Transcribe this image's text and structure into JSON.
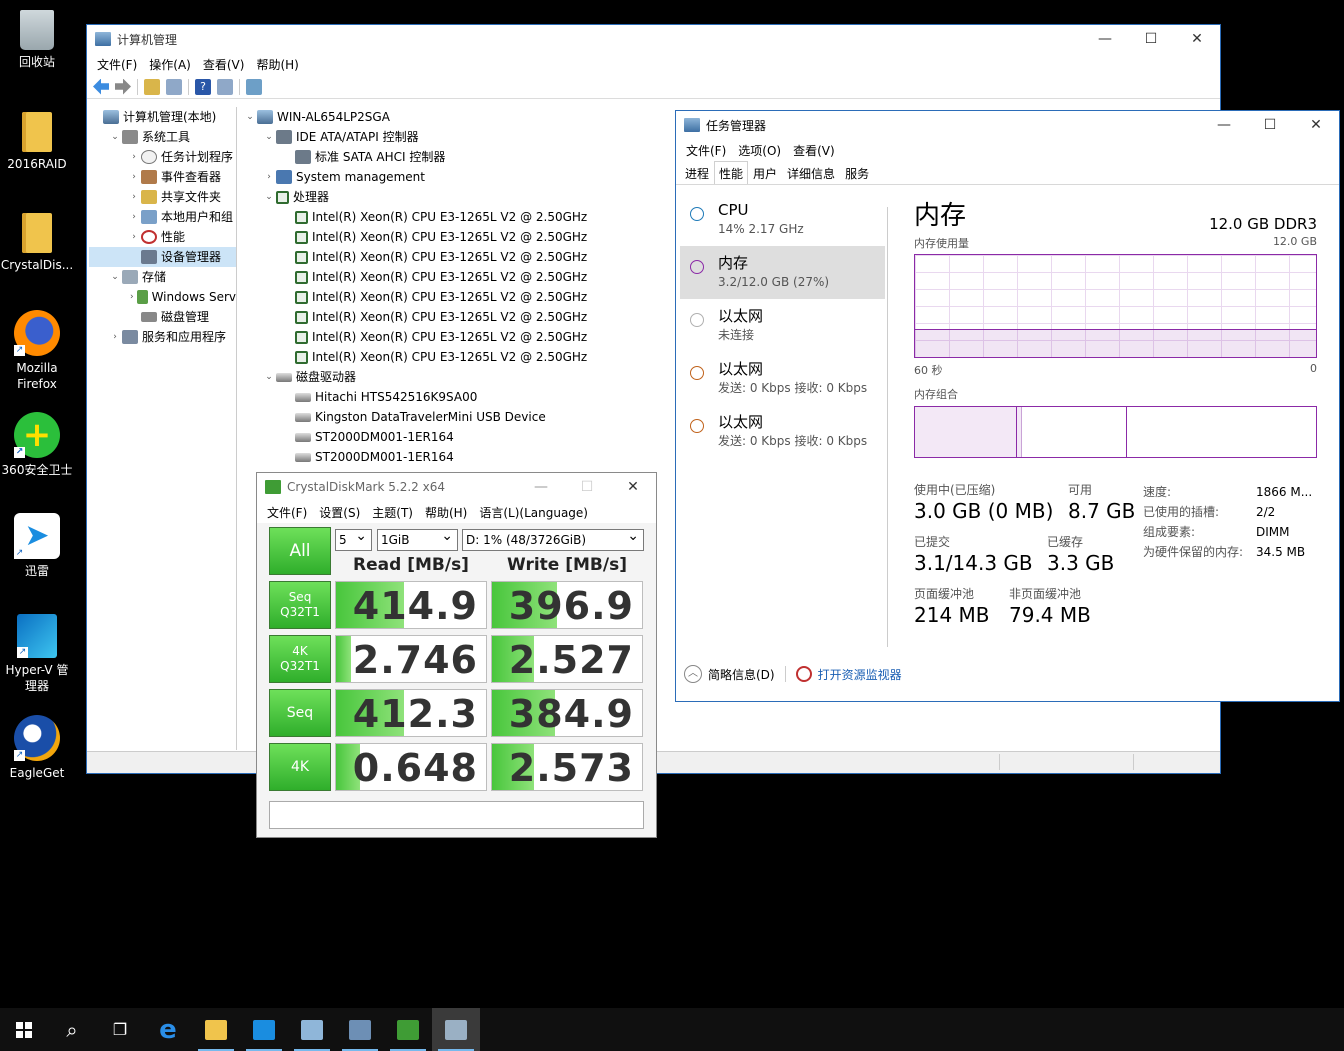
{
  "desktop": {
    "icons": [
      {
        "label": "回收站",
        "icon": "recycle-bin-icon"
      },
      {
        "label": "2016RAID",
        "icon": "folder-icon"
      },
      {
        "label": "CrystalDis...",
        "icon": "folder-icon"
      },
      {
        "label": "Mozilla\nFirefox",
        "icon": "firefox-icon"
      },
      {
        "label": "360安全卫士",
        "icon": "360-safe-icon"
      },
      {
        "label": "迅雷",
        "icon": "xunlei-icon"
      },
      {
        "label": "Hyper-V 管\n理器",
        "icon": "hyperv-icon"
      },
      {
        "label": "EagleGet",
        "icon": "eagleget-icon"
      }
    ]
  },
  "computer_management": {
    "title": "计算机管理",
    "menu": [
      "文件(F)",
      "操作(A)",
      "查看(V)",
      "帮助(H)"
    ],
    "left_tree": [
      {
        "label": "计算机管理(本地)",
        "level": 0,
        "icon": "computer-icon",
        "arrow": ""
      },
      {
        "label": "系统工具",
        "level": 1,
        "icon": "tools-icon",
        "arrow": "expanded"
      },
      {
        "label": "任务计划程序",
        "level": 2,
        "icon": "clock-icon",
        "arrow": "collapsed"
      },
      {
        "label": "事件查看器",
        "level": 2,
        "icon": "event-viewer-icon",
        "arrow": "collapsed"
      },
      {
        "label": "共享文件夹",
        "level": 2,
        "icon": "shared-folder-icon",
        "arrow": "collapsed"
      },
      {
        "label": "本地用户和组",
        "level": 2,
        "icon": "users-icon",
        "arrow": "collapsed"
      },
      {
        "label": "性能",
        "level": 2,
        "icon": "performance-icon",
        "arrow": "collapsed"
      },
      {
        "label": "设备管理器",
        "level": 2,
        "icon": "device-manager-icon",
        "arrow": "",
        "selected": true
      },
      {
        "label": "存储",
        "level": 1,
        "icon": "storage-icon",
        "arrow": "expanded"
      },
      {
        "label": "Windows Serv",
        "level": 2,
        "icon": "windows-server-backup-icon",
        "arrow": "collapsed"
      },
      {
        "label": "磁盘管理",
        "level": 2,
        "icon": "disk-icon",
        "arrow": ""
      },
      {
        "label": "服务和应用程序",
        "level": 1,
        "icon": "services-icon",
        "arrow": "collapsed"
      }
    ],
    "device_tree": [
      {
        "label": "WIN-AL654LP2SGA",
        "level": 0,
        "icon": "computer-icon",
        "arrow": "expanded"
      },
      {
        "label": "IDE ATA/ATAPI 控制器",
        "level": 1,
        "icon": "ide-controller-icon",
        "arrow": "expanded"
      },
      {
        "label": "标准 SATA AHCI 控制器",
        "level": 2,
        "icon": "ide-controller-icon",
        "arrow": ""
      },
      {
        "label": "System management",
        "level": 1,
        "icon": "system-icon",
        "arrow": "collapsed"
      },
      {
        "label": "处理器",
        "level": 1,
        "icon": "processor-icon",
        "arrow": "expanded"
      },
      {
        "label": "Intel(R) Xeon(R) CPU E3-1265L V2 @ 2.50GHz",
        "level": 2,
        "icon": "processor-icon",
        "arrow": ""
      },
      {
        "label": "Intel(R) Xeon(R) CPU E3-1265L V2 @ 2.50GHz",
        "level": 2,
        "icon": "processor-icon",
        "arrow": ""
      },
      {
        "label": "Intel(R) Xeon(R) CPU E3-1265L V2 @ 2.50GHz",
        "level": 2,
        "icon": "processor-icon",
        "arrow": ""
      },
      {
        "label": "Intel(R) Xeon(R) CPU E3-1265L V2 @ 2.50GHz",
        "level": 2,
        "icon": "processor-icon",
        "arrow": ""
      },
      {
        "label": "Intel(R) Xeon(R) CPU E3-1265L V2 @ 2.50GHz",
        "level": 2,
        "icon": "processor-icon",
        "arrow": ""
      },
      {
        "label": "Intel(R) Xeon(R) CPU E3-1265L V2 @ 2.50GHz",
        "level": 2,
        "icon": "processor-icon",
        "arrow": ""
      },
      {
        "label": "Intel(R) Xeon(R) CPU E3-1265L V2 @ 2.50GHz",
        "level": 2,
        "icon": "processor-icon",
        "arrow": ""
      },
      {
        "label": "Intel(R) Xeon(R) CPU E3-1265L V2 @ 2.50GHz",
        "level": 2,
        "icon": "processor-icon",
        "arrow": ""
      },
      {
        "label": "磁盘驱动器",
        "level": 1,
        "icon": "disk-drive-icon",
        "arrow": "expanded"
      },
      {
        "label": "Hitachi HTS542516K9SA00",
        "level": 2,
        "icon": "disk-drive-icon",
        "arrow": ""
      },
      {
        "label": "Kingston DataTravelerMini USB Device",
        "level": 2,
        "icon": "disk-drive-icon",
        "arrow": ""
      },
      {
        "label": "ST2000DM001-1ER164",
        "level": 2,
        "icon": "disk-drive-icon",
        "arrow": ""
      },
      {
        "label": "ST2000DM001-1ER164",
        "level": 2,
        "icon": "disk-drive-icon",
        "arrow": ""
      }
    ]
  },
  "task_manager": {
    "title": "任务管理器",
    "menu": [
      "文件(F)",
      "选项(O)",
      "查看(V)"
    ],
    "tabs": [
      "进程",
      "性能",
      "用户",
      "详细信息",
      "服务"
    ],
    "active_tab": 1,
    "side_items": [
      {
        "title": "CPU",
        "sub": "14% 2.17 GHz",
        "color": "#1f7ab8"
      },
      {
        "title": "内存",
        "sub": "3.2/12.0 GB (27%)",
        "color": "#8b2aa7",
        "active": true
      },
      {
        "title": "以太网",
        "sub": "未连接",
        "color": "#b0b0b0"
      },
      {
        "title": "以太网",
        "sub": "发送: 0 Kbps  接收: 0 Kbps",
        "color": "#c0621b"
      },
      {
        "title": "以太网",
        "sub": "发送: 0 Kbps  接收: 0 Kbps",
        "color": "#c0621b"
      }
    ],
    "memory": {
      "heading": "内存",
      "capacity": "12.0 GB DDR3",
      "usage_label": "内存使用量",
      "usage_max": "12.0 GB",
      "time_left": "60 秒",
      "time_right": "0",
      "composition_label": "内存组合",
      "in_use_label": "使用中(已压缩)",
      "in_use": "3.0 GB (0 MB)",
      "available_label": "可用",
      "available": "8.7 GB",
      "committed_label": "已提交",
      "committed": "3.1/14.3 GB",
      "cached_label": "已缓存",
      "cached": "3.3 GB",
      "paged_label": "页面缓冲池",
      "paged": "214 MB",
      "nonpaged_label": "非页面缓冲池",
      "nonpaged": "79.4 MB",
      "speed_label": "速度:",
      "speed": "1866 M...",
      "slots_label": "已使用的插槽:",
      "slots": "2/2",
      "form_label": "组成要素:",
      "form": "DIMM",
      "reserved_label": "为硬件保留的内存:",
      "reserved": "34.5 MB"
    },
    "footer": {
      "brief": "简略信息(D)",
      "resmon": "打开资源监视器"
    }
  },
  "crystaldiskmark": {
    "title": "CrystalDiskMark 5.2.2 x64",
    "menu": [
      "文件(F)",
      "设置(S)",
      "主题(T)",
      "帮助(H)",
      "语言(L)(Language)"
    ],
    "runs": "5",
    "size": "1GiB",
    "drive": "D: 1% (48/3726GiB)",
    "all_label": "All",
    "read_header": "Read [MB/s]",
    "write_header": "Write [MB/s]",
    "rows": [
      {
        "label1": "Seq",
        "label2": "Q32T1",
        "read": "414.9",
        "write": "396.9",
        "read_fill": 0.45,
        "write_fill": 0.43
      },
      {
        "label1": "4K",
        "label2": "Q32T1",
        "read": "2.746",
        "write": "2.527",
        "read_fill": 0.1,
        "write_fill": 0.28
      },
      {
        "label1": "Seq",
        "label2": "",
        "read": "412.3",
        "write": "384.9",
        "read_fill": 0.45,
        "write_fill": 0.42
      },
      {
        "label1": "4K",
        "label2": "",
        "read": "0.648",
        "write": "2.573",
        "read_fill": 0.16,
        "write_fill": 0.28
      }
    ]
  },
  "taskbar": {
    "items": [
      {
        "icon": "start-icon"
      },
      {
        "icon": "search-icon"
      },
      {
        "icon": "task-view-icon"
      },
      {
        "icon": "internet-explorer-icon"
      },
      {
        "icon": "file-explorer-icon",
        "running": true
      },
      {
        "icon": "xunlei-icon",
        "running": true
      },
      {
        "icon": "computer-management-icon",
        "running": true
      },
      {
        "icon": "server-manager-icon",
        "running": true
      },
      {
        "icon": "crystaldiskmark-icon",
        "running": true
      },
      {
        "icon": "task-manager-icon",
        "running": true,
        "active": true
      }
    ]
  }
}
